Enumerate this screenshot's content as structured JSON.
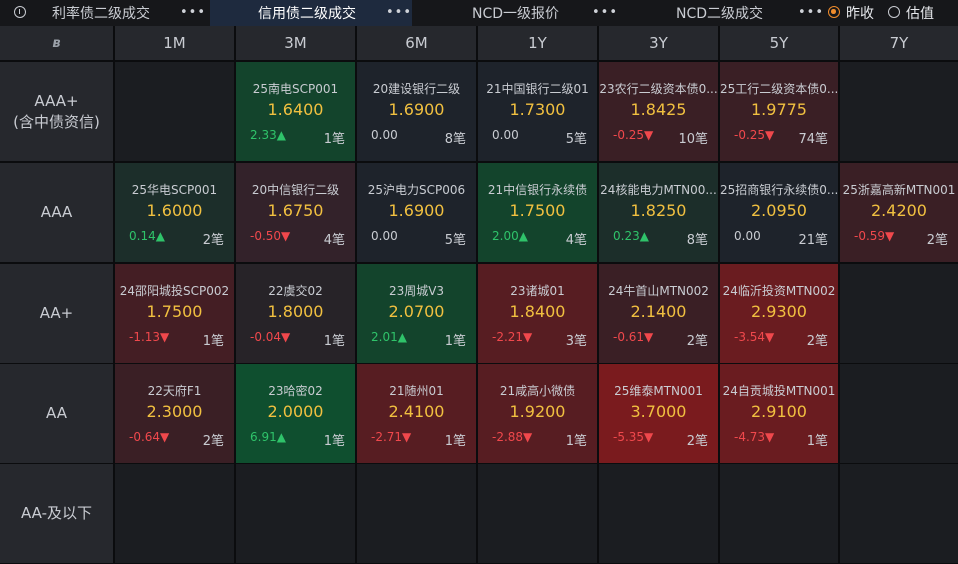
{
  "tabs": [
    {
      "label": "利率债二级成交",
      "dots": "•••",
      "active": false
    },
    {
      "label": "信用债二级成交",
      "dots": "•••",
      "active": true
    },
    {
      "label": "NCD一级报价",
      "dots": "•••",
      "active": false
    },
    {
      "label": "NCD二级成交",
      "dots": "•••",
      "active": false
    }
  ],
  "radios": [
    {
      "label": "昨收",
      "selected": true
    },
    {
      "label": "估值",
      "selected": false
    }
  ],
  "columns": [
    "1M",
    "3M",
    "6M",
    "1Y",
    "3Y",
    "5Y",
    "7Y"
  ],
  "rows": [
    {
      "line1": "AAA+",
      "line2": "(含中债资信)"
    },
    {
      "line1": "AAA",
      "line2": ""
    },
    {
      "line1": "AA+",
      "line2": ""
    },
    {
      "line1": "AA",
      "line2": ""
    },
    {
      "line1": "AA-及以下",
      "line2": ""
    }
  ],
  "cells": [
    [
      null,
      {
        "name": "25南电SCP001",
        "price": "1.6400",
        "change": "2.33▲",
        "dir": "up",
        "count": "1笔",
        "bg": "#13442c"
      },
      {
        "name": "20建设银行二级",
        "price": "1.6900",
        "change": "0.00",
        "dir": "flat",
        "count": "8笔",
        "bg": "#1e232b"
      },
      {
        "name": "21中国银行二级01",
        "price": "1.7300",
        "change": "0.00",
        "dir": "flat",
        "count": "5笔",
        "bg": "#1e232b"
      },
      {
        "name": "23农行二级资本债0...",
        "price": "1.8425",
        "change": "-0.25▼",
        "dir": "down",
        "count": "10笔",
        "bg": "#3a1f25"
      },
      {
        "name": "25工行二级资本债0...",
        "price": "1.9775",
        "change": "-0.25▼",
        "dir": "down",
        "count": "74笔",
        "bg": "#3a1f25"
      },
      null
    ],
    [
      {
        "name": "25华电SCP001",
        "price": "1.6000",
        "change": "0.14▲",
        "dir": "up",
        "count": "2笔",
        "bg": "#1c2e2a"
      },
      {
        "name": "20中信银行二级",
        "price": "1.6750",
        "change": "-0.50▼",
        "dir": "down",
        "count": "4笔",
        "bg": "#33222a"
      },
      {
        "name": "25沪电力SCP006",
        "price": "1.6900",
        "change": "0.00",
        "dir": "flat",
        "count": "5笔",
        "bg": "#1e232b"
      },
      {
        "name": "21中信银行永续债",
        "price": "1.7500",
        "change": "2.00▲",
        "dir": "up",
        "count": "4笔",
        "bg": "#13442c"
      },
      {
        "name": "24核能电力MTN00...",
        "price": "1.8250",
        "change": "0.23▲",
        "dir": "up",
        "count": "8笔",
        "bg": "#1c2e2a"
      },
      {
        "name": "25招商银行永续债0...",
        "price": "2.0950",
        "change": "0.00",
        "dir": "flat",
        "count": "21笔",
        "bg": "#1e232b"
      },
      {
        "name": "25浙嘉高新MTN001",
        "price": "2.4200",
        "change": "-0.59▼",
        "dir": "down",
        "count": "2笔",
        "bg": "#3a1f25"
      }
    ],
    [
      {
        "name": "24邵阳城投SCP002",
        "price": "1.7500",
        "change": "-1.13▼",
        "dir": "down",
        "count": "1笔",
        "bg": "#441e24"
      },
      {
        "name": "22虞交02",
        "price": "1.8000",
        "change": "-0.04▼",
        "dir": "down",
        "count": "1笔",
        "bg": "#272328"
      },
      {
        "name": "23周城V3",
        "price": "2.0700",
        "change": "2.01▲",
        "dir": "up",
        "count": "1笔",
        "bg": "#13442c"
      },
      {
        "name": "23诸城01",
        "price": "1.8400",
        "change": "-2.21▼",
        "dir": "down",
        "count": "3笔",
        "bg": "#571d22"
      },
      {
        "name": "24牛首山MTN002",
        "price": "2.1400",
        "change": "-0.61▼",
        "dir": "down",
        "count": "2笔",
        "bg": "#3a1f25"
      },
      {
        "name": "24临沂投资MTN002",
        "price": "2.9300",
        "change": "-3.54▼",
        "dir": "down",
        "count": "2笔",
        "bg": "#6a1c20"
      },
      null
    ],
    [
      {
        "name": "22天府F1",
        "price": "2.3000",
        "change": "-0.64▼",
        "dir": "down",
        "count": "2笔",
        "bg": "#3a1f25"
      },
      {
        "name": "23哈密02",
        "price": "2.0000",
        "change": "6.91▲",
        "dir": "up",
        "count": "1笔",
        "bg": "#0f4f2f"
      },
      {
        "name": "21随州01",
        "price": "2.4100",
        "change": "-2.71▼",
        "dir": "down",
        "count": "1笔",
        "bg": "#571d22"
      },
      {
        "name": "21咸高小微债",
        "price": "1.9200",
        "change": "-2.88▼",
        "dir": "down",
        "count": "1笔",
        "bg": "#571d22"
      },
      {
        "name": "25维泰MTN001",
        "price": "3.7000",
        "change": "-5.35▼",
        "dir": "down",
        "count": "2笔",
        "bg": "#7a1b1e"
      },
      {
        "name": "24自贡城投MTN001",
        "price": "2.9100",
        "change": "-4.73▼",
        "dir": "down",
        "count": "1笔",
        "bg": "#6a1c20"
      },
      null
    ],
    [
      null,
      null,
      null,
      null,
      null,
      null,
      null
    ]
  ]
}
